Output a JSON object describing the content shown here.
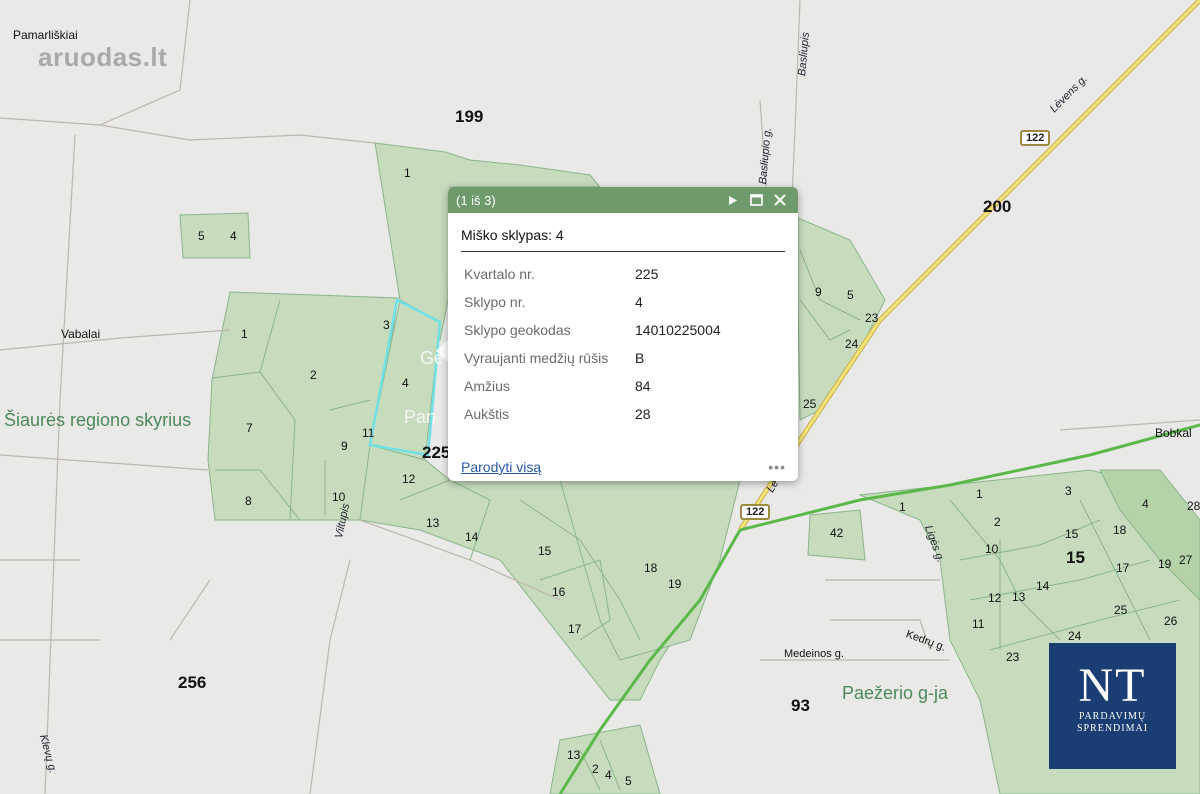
{
  "map": {
    "watermark": "aruodas.lt",
    "place_labels": [
      "Pamarliškiai",
      "Vabalai",
      "Bobkal",
      "Medeinos g.",
      "Kedrų g."
    ],
    "area_labels": [
      "Šiaurės regiono skyrius",
      "Paežerio g-ja",
      "Ge",
      "Pan"
    ],
    "block_numbers": [
      "199",
      "200",
      "256",
      "93",
      "225",
      "15"
    ],
    "road_labels": [
      "Basliupis",
      "Basliupio g.",
      "Lėvens g.",
      "Viltupis",
      "Klevų g.",
      "Ligės g.",
      "Lėvens g."
    ],
    "road_shields": [
      "122",
      "122"
    ],
    "parcel_numbers": [
      "1",
      "5",
      "4",
      "1",
      "2",
      "3",
      "4",
      "7",
      "9",
      "8",
      "10",
      "11",
      "12",
      "13",
      "14",
      "15",
      "16",
      "17",
      "18",
      "19",
      "9",
      "5",
      "23",
      "24",
      "25",
      "1",
      "3",
      "2",
      "10",
      "15",
      "18",
      "14",
      "12",
      "13",
      "11",
      "17",
      "19",
      "27",
      "4",
      "28",
      "42",
      "1",
      "23",
      "24",
      "25",
      "26",
      "13",
      "2",
      "4",
      "5"
    ]
  },
  "popup": {
    "counter": "(1 iš 3)",
    "title": "Miško sklypas: 4",
    "rows": [
      {
        "label": "Kvartalo nr.",
        "value": "225"
      },
      {
        "label": "Sklypo nr.",
        "value": "4"
      },
      {
        "label": "Sklypo geokodas",
        "value": "14010225004"
      },
      {
        "label": "Vyraujanti medžių rūšis",
        "value": "B"
      },
      {
        "label": "Amžius",
        "value": "84"
      },
      {
        "label": "Aukštis",
        "value": "28"
      }
    ],
    "link": "Parodyti visą",
    "more": "•••",
    "icons": [
      "play-icon",
      "maximize-icon",
      "close-icon"
    ]
  },
  "logo": {
    "mark": "NT",
    "line1": "PARDAVIMŲ",
    "line2": "SPRENDIMAI"
  },
  "colors": {
    "forest": "#c6dcbd",
    "forest_border": "#8ab58a",
    "popup_header": "#6f9a6b",
    "highway": "#f2e27a",
    "boundary": "#5cb84a",
    "logo_bg": "#1a3d73"
  }
}
